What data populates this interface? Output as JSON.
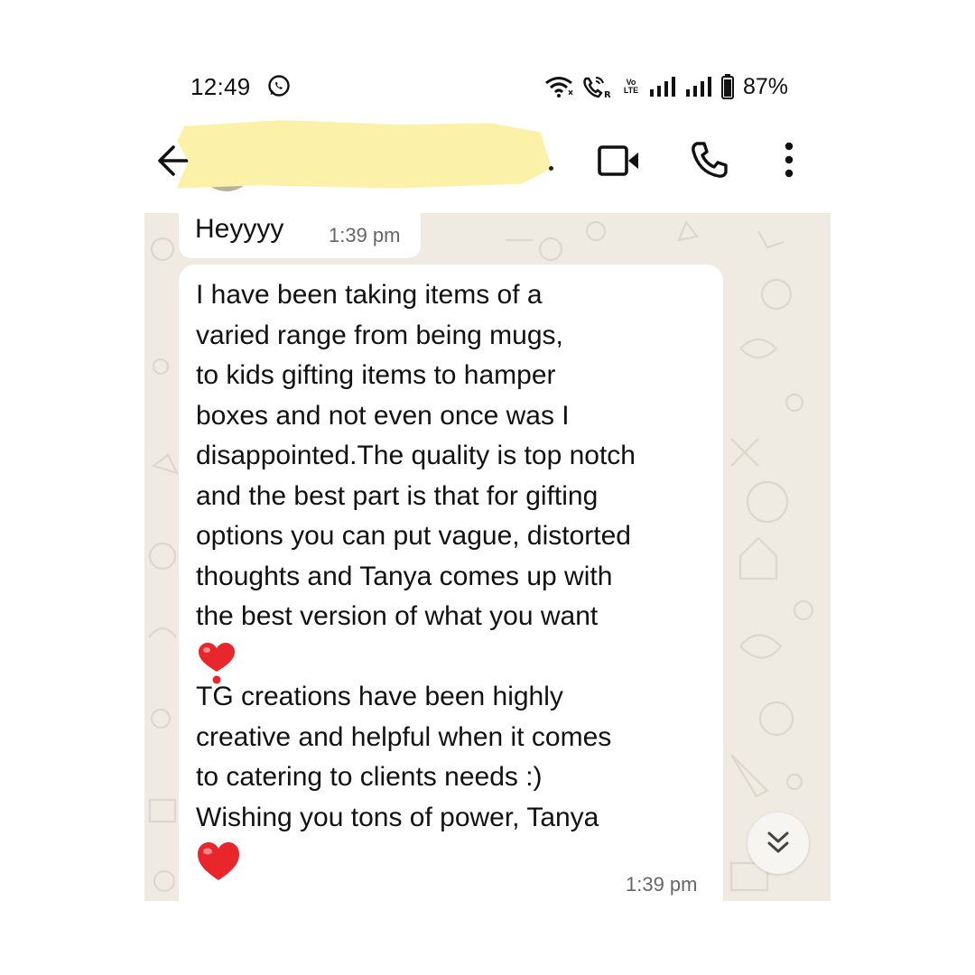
{
  "status_bar": {
    "time": "12:49",
    "battery": "87%",
    "volte_top": "Vo",
    "volte_bottom": "LTE"
  },
  "header": {
    "contact_name_visible": "."
  },
  "messages": [
    {
      "text": "Heyyyy",
      "time": "1:39 pm"
    },
    {
      "lines_part1": [
        "I have been taking items of a",
        "varied range from being mugs,",
        "to kids gifting items to hamper",
        "boxes and not even once was I",
        "disappointed.The quality is top notch",
        "and the best part is that for gifting",
        "options you can put vague, distorted",
        "thoughts and Tanya comes up with",
        "the best version of what you want"
      ],
      "emoji_1": "❣️",
      "lines_part2": [
        "TG creations have been highly",
        "creative and helpful when it comes",
        "to catering to clients needs :)",
        "Wishing you tons of power, Tanya"
      ],
      "emoji_2": "❤️",
      "time": "1:39 pm"
    }
  ],
  "colors": {
    "chat_background": "#efeae2",
    "bubble": "#ffffff",
    "redaction": "#fcf1a8",
    "heart": "#e8262c"
  },
  "icons": {
    "back": "arrow-left-icon",
    "video": "video-call-icon",
    "call": "phone-icon",
    "menu": "more-vert-icon",
    "scroll": "double-chevron-down-icon"
  }
}
